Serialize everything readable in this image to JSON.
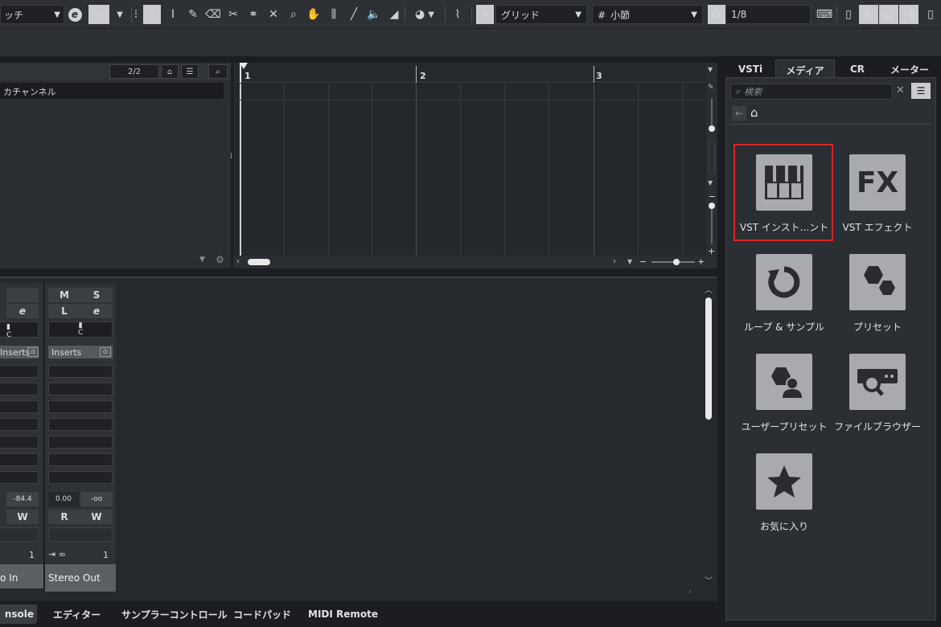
{
  "toolbar": {
    "left_field": "ッチ",
    "grid_type": "グリッド",
    "grid_value": "小節",
    "quantize_value": "1/8"
  },
  "project": {
    "page_counter": "2/2",
    "track_name": "カチャンネル",
    "ruler_bars": [
      "1",
      "2",
      "3"
    ]
  },
  "mixer": {
    "strip1": {
      "inserts": "Inserts",
      "level": "-84.4",
      "count": "1",
      "name": "o In"
    },
    "strip2": {
      "m": "M",
      "s": "S",
      "l": "L",
      "pan": "C",
      "inserts": "Inserts",
      "level": "0.00",
      "peak": "-oo",
      "r": "R",
      "w": "W",
      "count": "1",
      "name": "Stereo Out"
    }
  },
  "bottom_tabs": [
    "nsole",
    "エディター",
    "サンプラーコントロール",
    "コードパッド",
    "MIDI Remote"
  ],
  "right_tabs": [
    "VSTi",
    "メディア",
    "CR",
    "メーター"
  ],
  "media": {
    "search_placeholder": "検索",
    "tiles": [
      {
        "label": "VST インスト...ント",
        "icon": "piano-keys-icon"
      },
      {
        "label": "VST エフェクト",
        "icon": "fx-icon",
        "glyph": "FX"
      },
      {
        "label": "ループ & サンプル",
        "icon": "loop-icon"
      },
      {
        "label": "プリセット",
        "icon": "hexagons-icon"
      },
      {
        "label": "ユーザープリセット",
        "icon": "user-preset-icon"
      },
      {
        "label": "ファイルブラウザー",
        "icon": "file-browser-icon"
      },
      {
        "label": "お気に入り",
        "icon": "star-icon"
      }
    ]
  },
  "colors": {
    "highlight": "#d8262a",
    "tile": "#a8aaad",
    "background": "#1b1d20"
  }
}
